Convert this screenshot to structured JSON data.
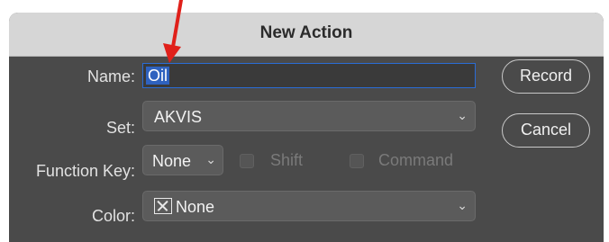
{
  "dialog": {
    "title": "New Action"
  },
  "form": {
    "name_label": "Name:",
    "name_value": "Oil",
    "set_label": "Set:",
    "set_value": "AKVIS",
    "function_key_label": "Function Key:",
    "function_key_value": "None",
    "shift_label": "Shift",
    "shift_checked": false,
    "command_label": "Command",
    "command_checked": false,
    "color_label": "Color:",
    "color_value": "None"
  },
  "buttons": {
    "record_label": "Record",
    "cancel_label": "Cancel"
  },
  "icons": {
    "chevron": "chevron-down-icon",
    "color_none": "x-box-icon",
    "annotation": "red-arrow-annotation"
  },
  "colors": {
    "dialog_bg": "#4a4a4a",
    "titlebar_bg": "#d6d6d6",
    "selection": "#2f62bf",
    "focus_border": "#2a6cd6",
    "annotation_arrow": "#e0201a"
  }
}
